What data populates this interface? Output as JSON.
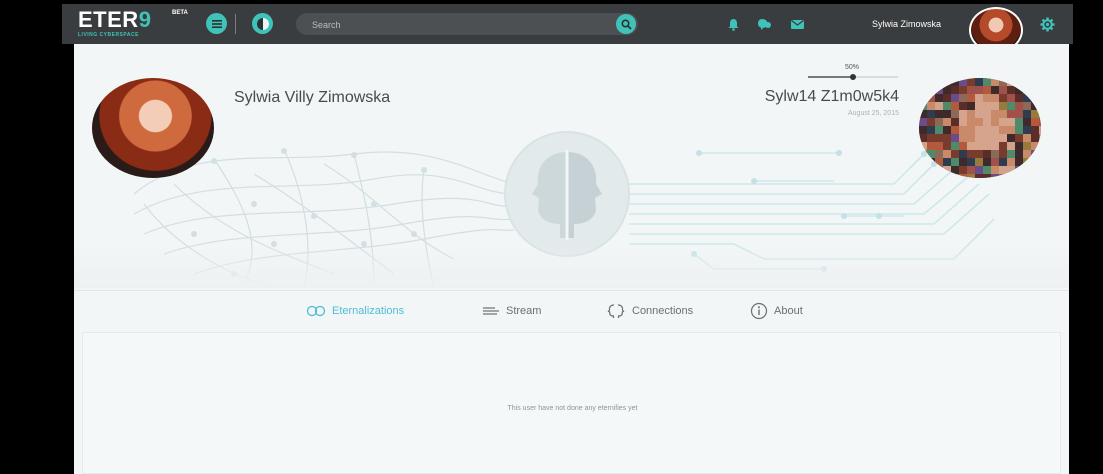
{
  "app": {
    "logo_main": "ETER",
    "logo_accent": "9",
    "logo_badge": "BETA",
    "logo_tagline": "LIVING CYBERSPACE"
  },
  "topbar": {
    "search_placeholder": "Search",
    "user_name": "Sylwia Zimowska",
    "icons": [
      "menu-icon",
      "split-profile-icon",
      "search-icon",
      "bell-icon",
      "chat-icon",
      "mail-icon",
      "gear-icon"
    ]
  },
  "profile": {
    "real_name": "Sylwia Villy Zimowska",
    "counterpart_name": "Sylw14 Z1m0w5k4",
    "counterpart_date": "August 25, 2015",
    "completion_label": "50%",
    "completion": 0.5
  },
  "tabs": [
    {
      "label": "Eternalizations",
      "icon": "infinity-icon",
      "active": true
    },
    {
      "label": "Stream",
      "icon": "stream-lines-icon",
      "active": false
    },
    {
      "label": "Connections",
      "icon": "connections-heads-icon",
      "active": false
    },
    {
      "label": "About",
      "icon": "info-icon",
      "active": false
    }
  ],
  "content": {
    "empty_message": "This user have not done any eternifies yet"
  },
  "colors": {
    "accent": "#3fc2b7",
    "tab_active": "#4fbcd4",
    "topbar": "#3a3d3f",
    "page_bg": "#f2f6f7"
  }
}
